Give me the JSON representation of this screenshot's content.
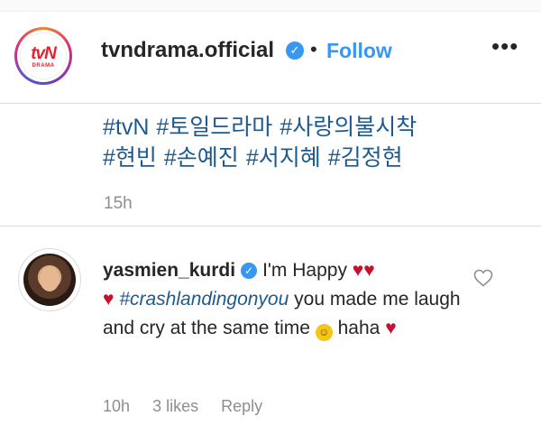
{
  "post": {
    "username": "tvndrama.official",
    "follow_label": "Follow",
    "separator": "•",
    "more_glyph": "•••",
    "logo": {
      "main": "tvN",
      "sub": "DRAMA"
    },
    "hashtags": [
      "#tvN",
      "#토일드라마",
      "#사랑의불시착",
      "#현빈",
      "#손예진",
      "#서지혜",
      "#김정현"
    ],
    "time": "15h"
  },
  "comment": {
    "username": "yasmien_kurdi",
    "text_1": "I'm Happy",
    "hearts_1": "♥♥",
    "heart_2": "♥",
    "hashtag": "#crashlandingonyou",
    "text_2": "you made me laugh and cry at the same time",
    "text_3": "haha",
    "heart_3": "♥",
    "time": "10h",
    "likes": "3 likes",
    "reply_label": "Reply"
  },
  "icons": {
    "verified": "verified-check-icon",
    "heart": "heart-outline-icon",
    "emoji": "smiling-face-icon"
  },
  "colors": {
    "link": "#3897f0",
    "hashtag": "#1d5a8f",
    "heart": "#c8102e",
    "muted": "#8e8e8e"
  }
}
